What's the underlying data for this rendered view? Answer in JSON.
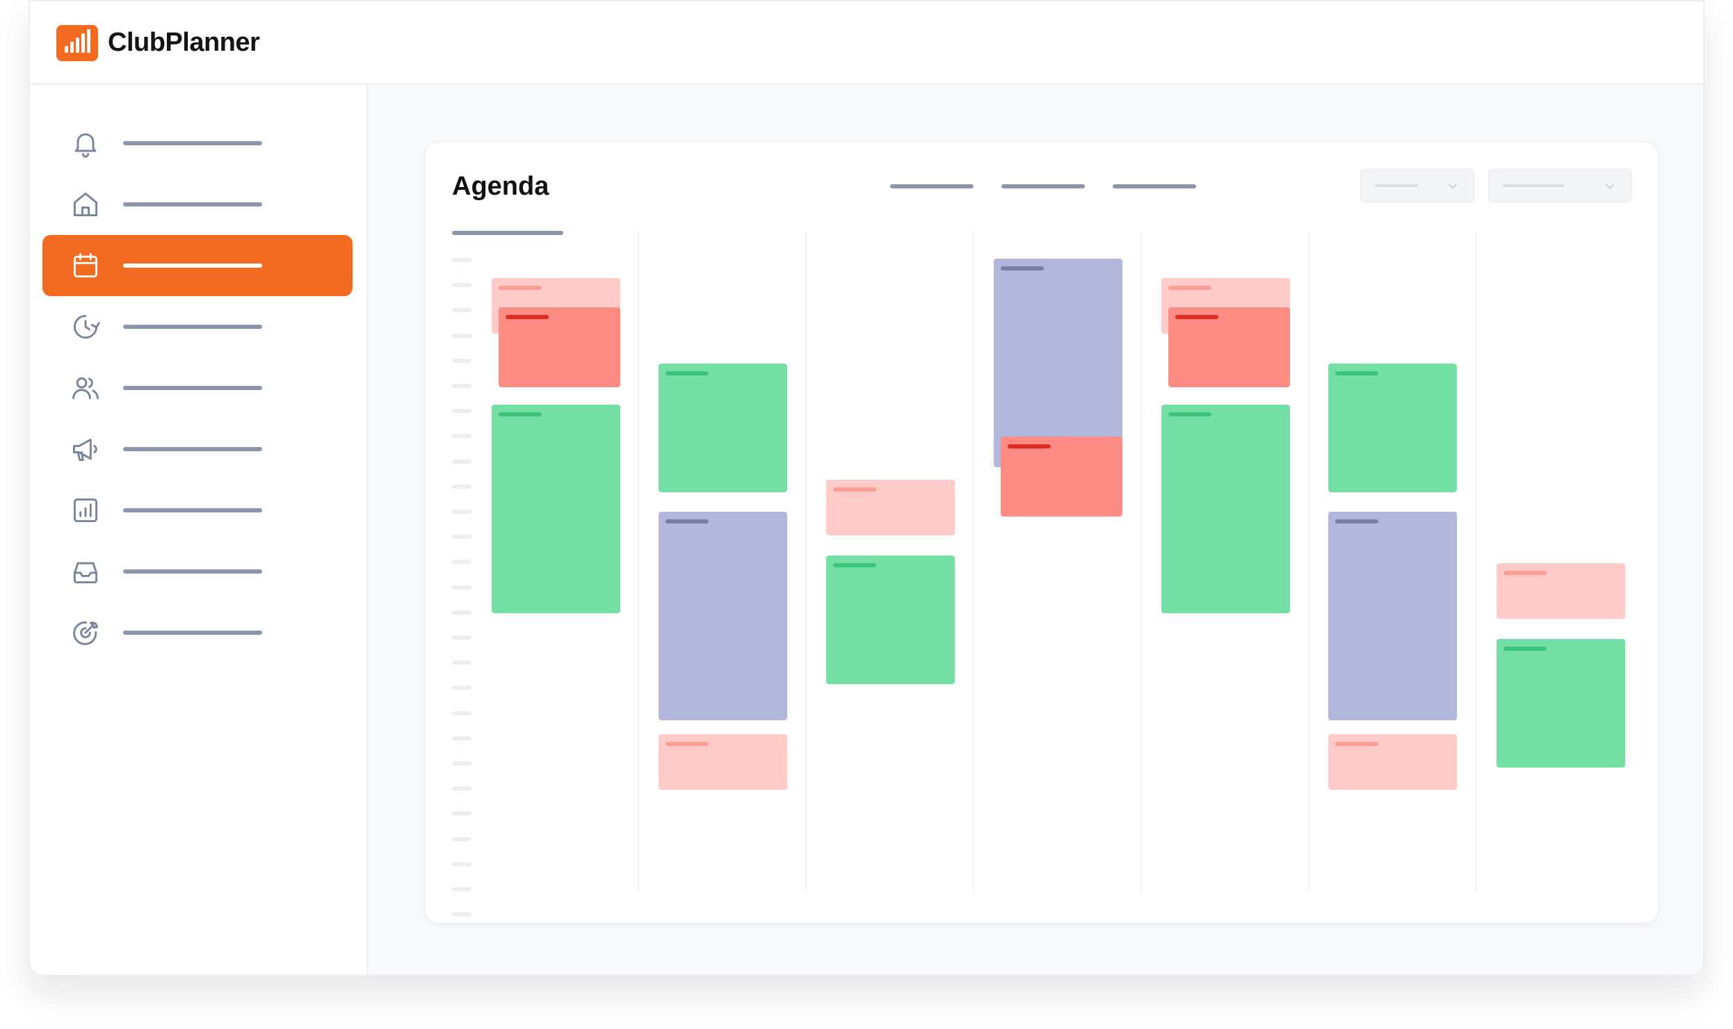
{
  "app": {
    "name": "ClubPlanner",
    "accent_color": "#f26b21"
  },
  "sidebar": {
    "items": [
      {
        "icon": "bell-icon",
        "active": false
      },
      {
        "icon": "home-icon",
        "active": false
      },
      {
        "icon": "calendar-icon",
        "active": true
      },
      {
        "icon": "clock-refresh-icon",
        "active": false
      },
      {
        "icon": "users-icon",
        "active": false
      },
      {
        "icon": "megaphone-icon",
        "active": false
      },
      {
        "icon": "chart-icon",
        "active": false
      },
      {
        "icon": "inbox-icon",
        "active": false
      },
      {
        "icon": "target-icon",
        "active": false
      }
    ]
  },
  "agenda": {
    "title": "Agenda",
    "event_colors": {
      "green": "#74e0a5",
      "blue": "#b3b7db",
      "pink": "#ffcbc8",
      "red": "#ff8c84"
    }
  }
}
